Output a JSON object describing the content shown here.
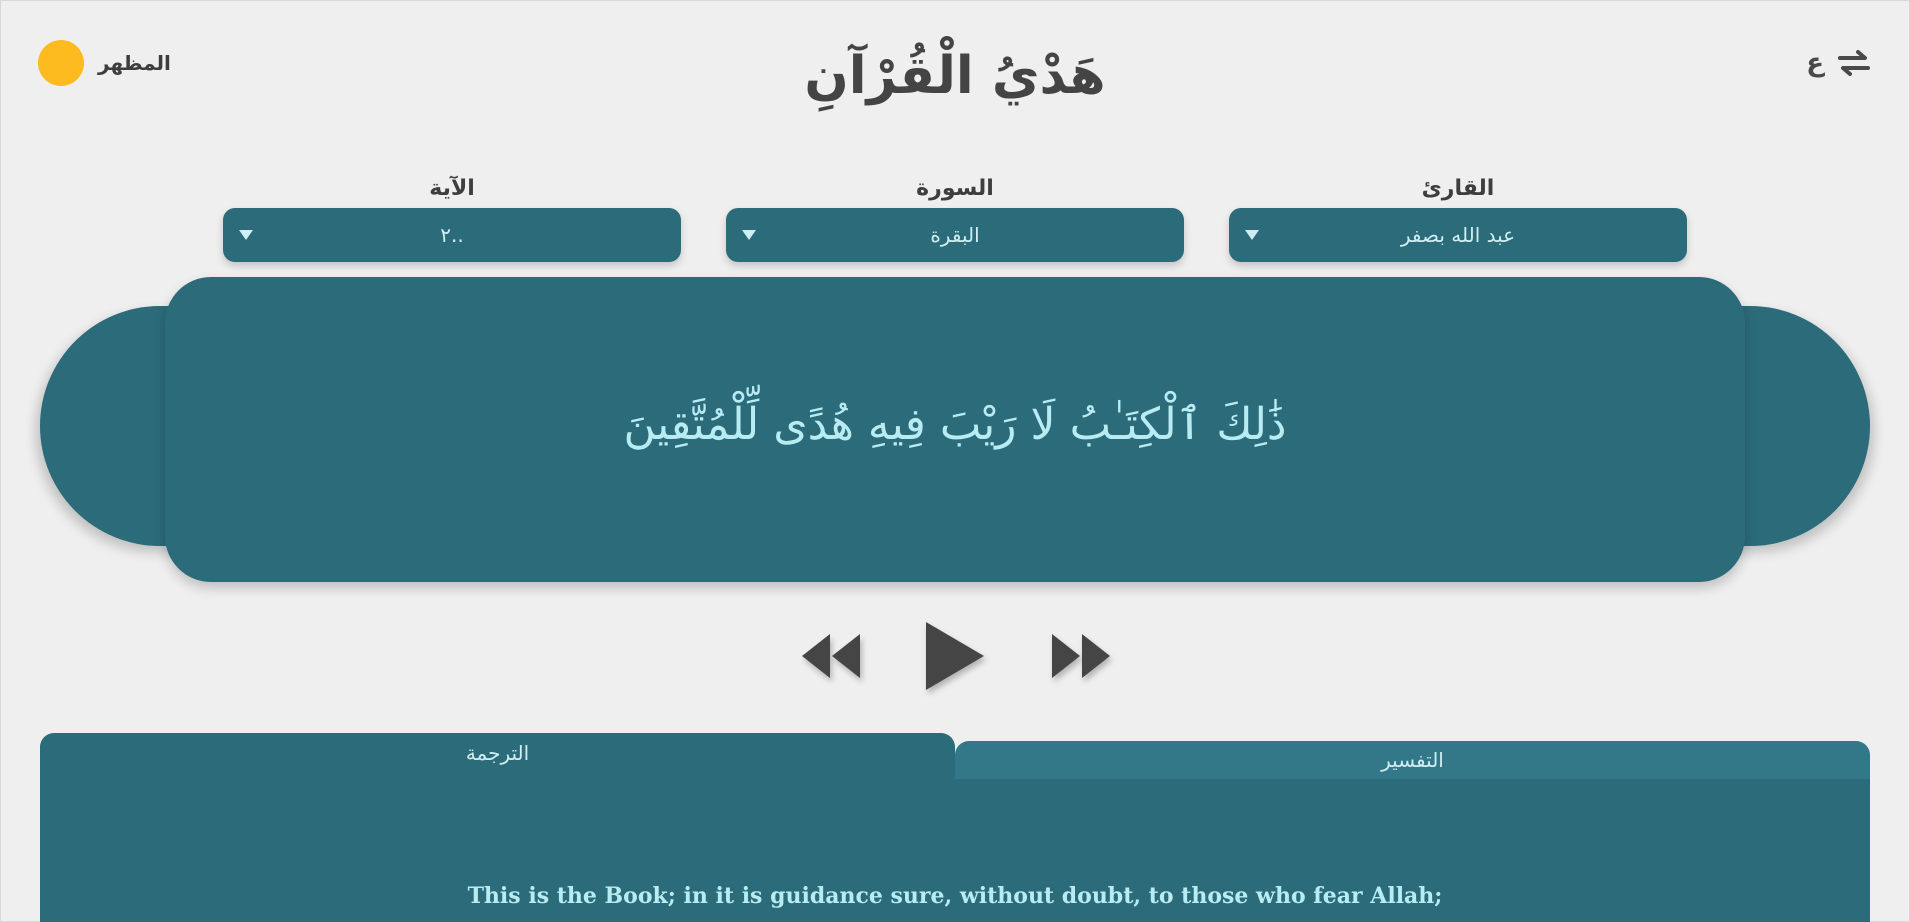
{
  "header": {
    "title": "هَدْيُ الْقُرْآنِ",
    "theme_label": "المظهر",
    "language_letter": "ع",
    "colors": {
      "theme_dot": "#fdbb20",
      "primary": "#2b6b7a",
      "text_light": "#b8ecf2"
    }
  },
  "selectors": {
    "reciter": {
      "label": "القارئ",
      "value": "عبد الله بصفر"
    },
    "surah": {
      "label": "السورة",
      "value": "البقرة"
    },
    "ayah": {
      "label": "الآية",
      "value": "٢.."
    }
  },
  "verse": {
    "arabic": "ذَٰلِكَ ٱلْكِتَـٰبُ لَا رَيْبَ فِيهِ هُدًى لِّلْمُتَّقِينَ"
  },
  "player": {
    "icons": [
      "rewind-icon",
      "play-icon",
      "fast-forward-icon"
    ]
  },
  "tabs": {
    "translation_label": "الترجمة",
    "tafsir_label": "التفسير",
    "active": "translation"
  },
  "translation": {
    "text": "This is the Book; in it is guidance sure, without doubt, to those who fear Allah;"
  }
}
